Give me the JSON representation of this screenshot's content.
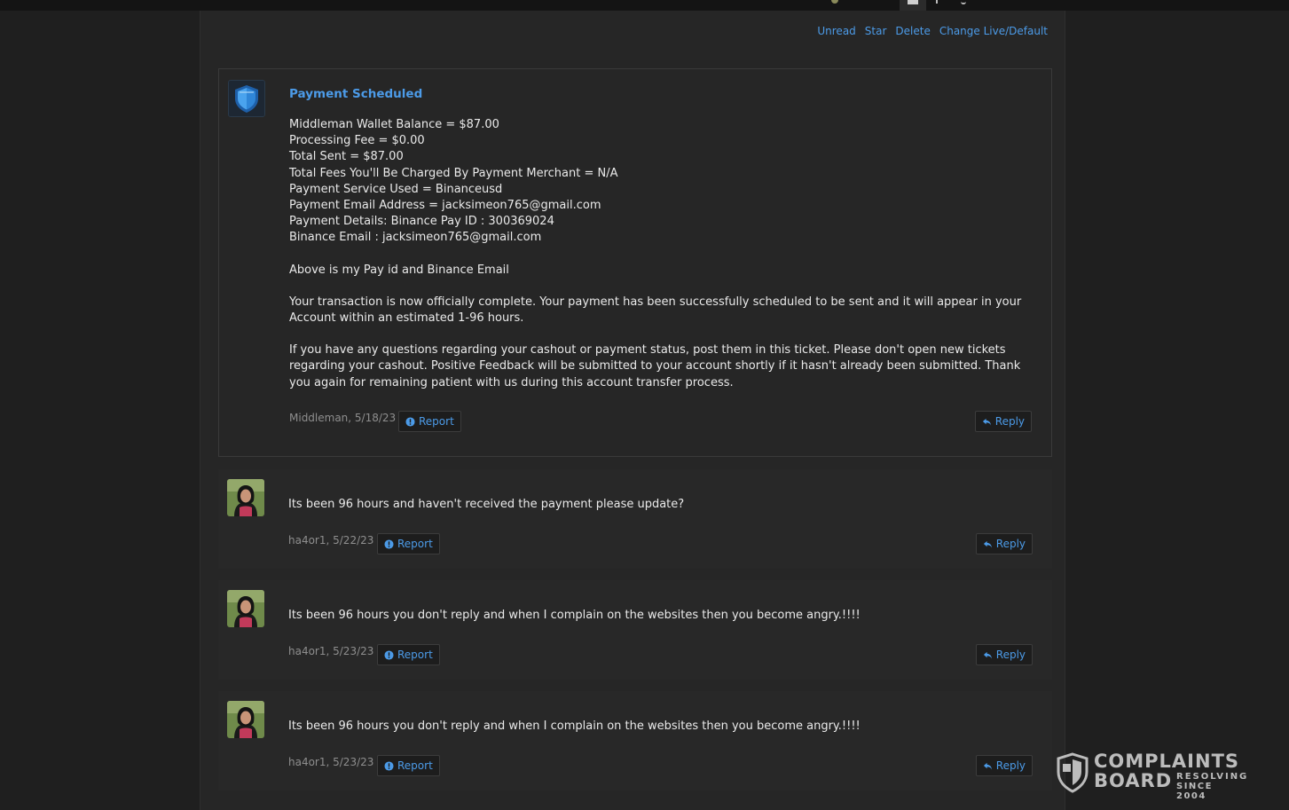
{
  "actions": {
    "unread": "Unread",
    "star": "Star",
    "delete": "Delete",
    "change": "Change Live/Default"
  },
  "messages": [
    {
      "title": "Payment Scheduled",
      "lines": [
        "Middleman Wallet Balance = $87.00",
        "Processing Fee = $0.00",
        "Total Sent = $87.00",
        "Total Fees You'll Be Charged By Payment Merchant = N/A",
        "Payment Service Used = Binanceusd",
        "Payment Email Address = jacksimeon765@gmail.com",
        "Payment Details: Binance Pay ID : 300369024",
        "Binance Email : jacksimeon765@gmail.com"
      ],
      "para1": "Above is my Pay id and Binance Email",
      "para2": "Your transaction is now officially complete. Your payment has been successfully scheduled to be sent and it will appear in your Account within an estimated 1-96 hours.",
      "para3": "If you have any questions regarding your cashout or payment status, post them in this ticket. Please don't open new tickets regarding your cashout. Positive Feedback will be submitted to your account shortly if it hasn't already been submitted. Thank you again for remaining patient with us during this account transfer process.",
      "meta": "Middleman, 5/18/23",
      "report": "Report",
      "reply": "Reply"
    },
    {
      "text": "Its been 96 hours and haven't received the payment please update?",
      "meta": "ha4or1, 5/22/23",
      "report": "Report",
      "reply": "Reply"
    },
    {
      "text": "Its been 96 hours you don't reply and when I complain on the websites then you become angry.!!!!",
      "meta": "ha4or1, 5/23/23",
      "report": "Report",
      "reply": "Reply"
    },
    {
      "text": "Its been 96 hours you don't reply and when I complain on the websites then you become angry.!!!!",
      "meta": "ha4or1, 5/23/23",
      "report": "Report",
      "reply": "Reply"
    }
  ],
  "watermark": {
    "line1": "COMPLAINTS",
    "line2": "BOARD",
    "tag1": "RESOLVING",
    "tag2": "SINCE 2004"
  },
  "colors": {
    "link": "#4c9be8",
    "background": "#1f1f1f",
    "panel": "#262626"
  },
  "icons": [
    "shield-icon",
    "info-icon",
    "reply-arrow-icon"
  ]
}
